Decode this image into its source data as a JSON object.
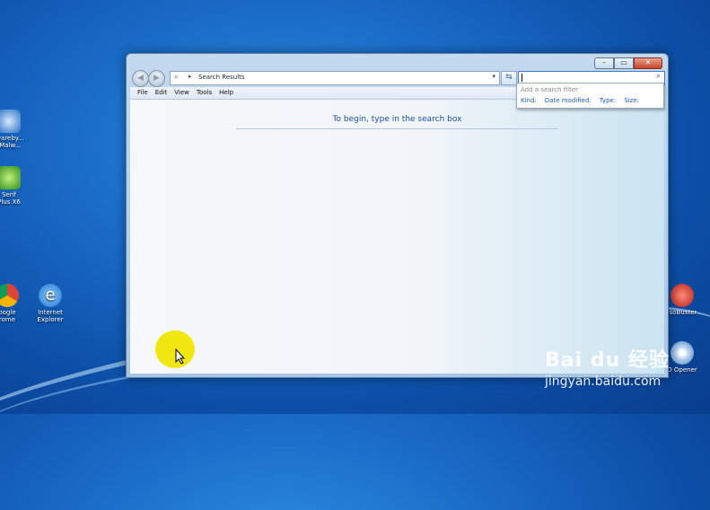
{
  "desktop": {
    "icons_left": [
      {
        "label_line1": "lwareby...",
        "label_line2": "-Malw..."
      },
      {
        "label_line1": "Serif",
        "label_line2": "Plus X6"
      },
      {
        "label_line1": "oogle",
        "label_line2": "rome"
      },
      {
        "label_line1": "Internet",
        "label_line2": "Explorer"
      }
    ],
    "icons_right": [
      {
        "label": "IsoBuster"
      },
      {
        "label": "O Opener"
      }
    ]
  },
  "window": {
    "address_text": "Search Results",
    "search_value": "",
    "menu": [
      "File",
      "Edit",
      "View",
      "Tools",
      "Help"
    ],
    "filter_popup": {
      "hint": "Add a search filter",
      "options": [
        "Kind:",
        "Date modified:",
        "Type:",
        "Size:"
      ]
    },
    "content_message": "To begin, type in the search box"
  },
  "watermark": {
    "brand": "Bai  du 经验",
    "url": "jingyan.baidu.com"
  },
  "colors": {
    "desktop_blue": "#1a6cc8",
    "link_blue": "#1f5fbf",
    "message_blue": "#1e4fa0",
    "cursor_highlight": "#eee600"
  }
}
